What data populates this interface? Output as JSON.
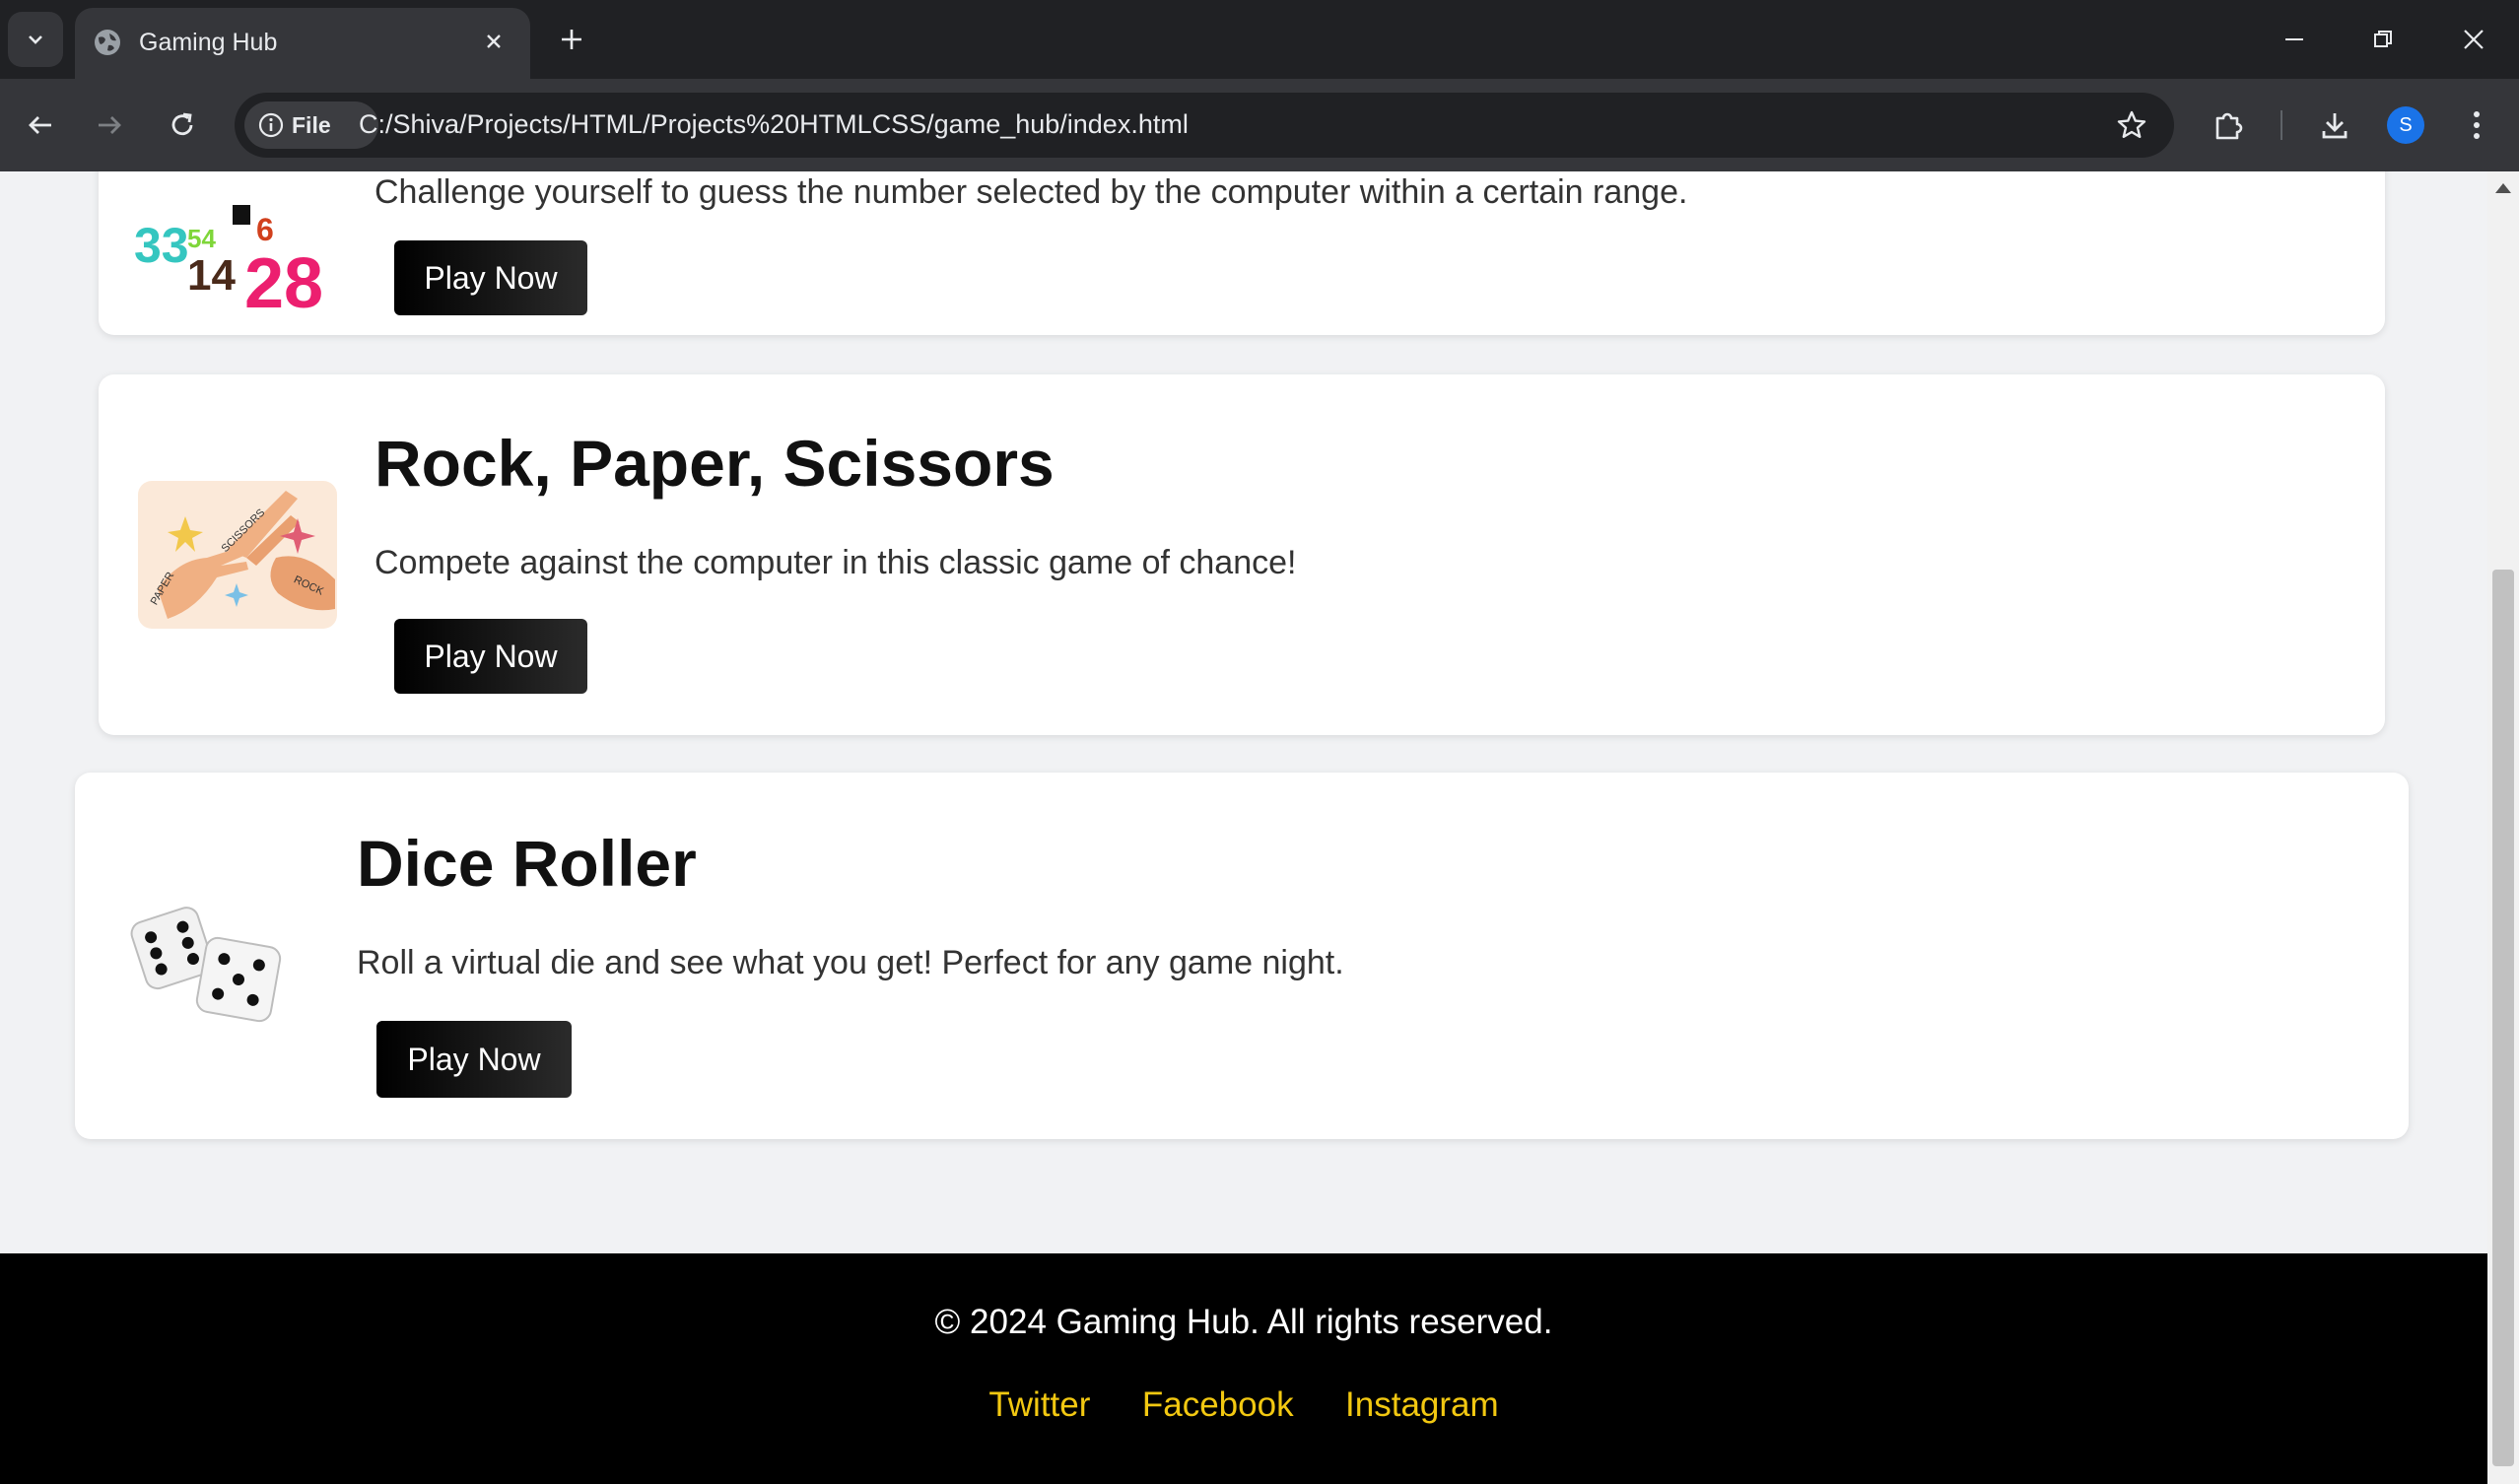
{
  "browser": {
    "tab_title": "Gaming Hub",
    "chip_label": "File",
    "url": "C:/Shiva/Projects/HTML/Projects%20HTMLCSS/game_hub/index.html",
    "profile_initial": "S"
  },
  "games": [
    {
      "title": "",
      "description": "Challenge yourself to guess the number selected by the computer within a certain range.",
      "button": "Play Now",
      "image_numbers": [
        "33",
        "54",
        "6",
        "14",
        "28"
      ]
    },
    {
      "title": "Rock, Paper, Scissors",
      "description": "Compete against the computer in this classic game of chance!",
      "button": "Play Now",
      "image_words": [
        "SCISSORS",
        "PAPER",
        "ROCK"
      ]
    },
    {
      "title": "Dice Roller",
      "description": "Roll a virtual die and see what you get! Perfect for any game night.",
      "button": "Play Now"
    }
  ],
  "footer": {
    "copyright": "© 2024 Gaming Hub. All rights reserved.",
    "links": [
      "Twitter",
      "Facebook",
      "Instagram"
    ]
  },
  "colors": {
    "footer_link": "#f2c811",
    "page_bg": "#f1f2f4"
  }
}
